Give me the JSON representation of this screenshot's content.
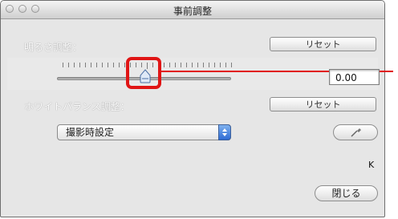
{
  "window": {
    "title": "事前調整"
  },
  "brightness": {
    "label": "明るさ調整：",
    "reset_label": "リセット",
    "value": "0.00",
    "slider_level": 0.5
  },
  "white_balance": {
    "label": "ホワイトバランス調整：",
    "reset_label": "リセット",
    "select_value": "撮影時設定",
    "kelvin_unit": "K"
  },
  "footer": {
    "close_label": "閉じる"
  },
  "colors": {
    "highlight": "#e01515",
    "select_accent": "#2f6bd4"
  },
  "icons": {
    "picker": "eyedropper-icon",
    "select": "updown-arrows-icon"
  }
}
